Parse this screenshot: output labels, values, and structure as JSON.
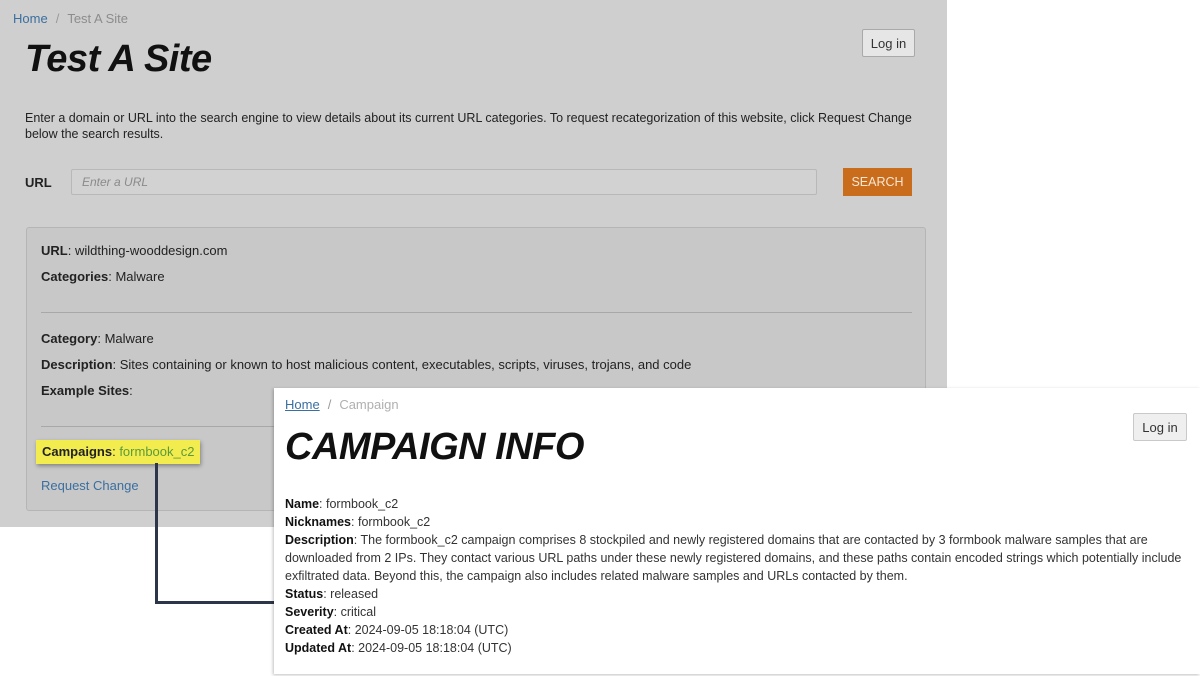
{
  "back": {
    "breadcrumb": {
      "home": "Home",
      "separator": "/",
      "current": "Test A Site"
    },
    "title": "Test A Site",
    "login_label": "Log in",
    "intro": "Enter a domain or URL into the search engine to view details about its current URL categories. To request recategorization of this website, click Request Change below the search results.",
    "url_label": "URL",
    "url_placeholder": "Enter a URL",
    "search_label": "SEARCH",
    "result": {
      "url_key": "URL",
      "url_value": "wildthing-wooddesign.com",
      "categories_key": "Categories",
      "categories_value": "Malware",
      "category_key": "Category",
      "category_value": "Malware",
      "description_key": "Description",
      "description_value": "Sites containing or known to host malicious content, executables, scripts, viruses, trojans, and code",
      "example_key": "Example Sites",
      "example_value": "",
      "campaigns_key": "Campaigns",
      "campaigns_value": "formbook_c2",
      "request_change": "Request Change"
    },
    "colors": {
      "search_button": "#c96d1c",
      "highlight": "#f2ec4e",
      "link": "#3a6fa0",
      "connector": "#2d3648"
    }
  },
  "front": {
    "breadcrumb": {
      "home": "Home",
      "separator": "/",
      "current": "Campaign"
    },
    "title": "CAMPAIGN INFO",
    "login_label": "Log in",
    "fields": {
      "name_key": "Name",
      "name_value": "formbook_c2",
      "nicknames_key": "Nicknames",
      "nicknames_value": "formbook_c2",
      "description_key": "Description",
      "description_value": "The formbook_c2 campaign comprises 8 stockpiled and newly registered domains that are contacted by 3 formbook malware samples that are downloaded from 2 IPs. They contact various URL paths under these newly registered domains, and these paths contain encoded strings which potentially include exfiltrated data. Beyond this, the campaign also includes related malware samples and URLs contacted by them.",
      "status_key": "Status",
      "status_value": "released",
      "severity_key": "Severity",
      "severity_value": "critical",
      "created_key": "Created At",
      "created_value": "2024-09-05 18:18:04 (UTC)",
      "updated_key": "Updated At",
      "updated_value": "2024-09-05 18:18:04 (UTC)"
    }
  }
}
